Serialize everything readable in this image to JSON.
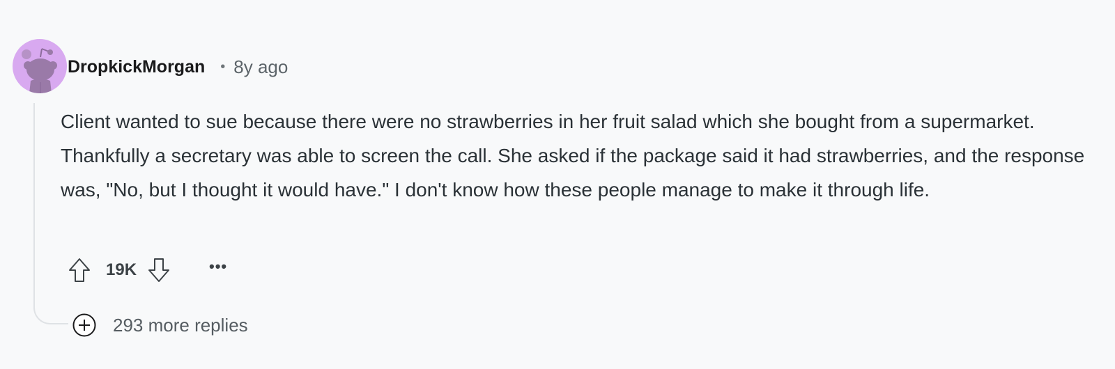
{
  "comment": {
    "author": "DropkickMorgan",
    "separator": "•",
    "age": "8y ago",
    "body": "Client wanted to sue because there were no strawberries in her fruit salad which she bought from a supermarket. Thankfully a secretary was able to screen the call. She asked if the package said it had strawberries, and the response was, \"No, but I thought it would have.\" I don't know how these people manage to make it through life.",
    "score": "19K",
    "more_label": "•••",
    "more_replies": "293 more replies"
  },
  "icons": {
    "avatar": "reddit-snoo-avatar",
    "upvote": "upvote-arrow-icon",
    "downvote": "downvote-arrow-icon",
    "more": "ellipsis-icon",
    "expand": "plus-circle-icon"
  },
  "colors": {
    "background": "#f8f9fa",
    "avatar_bg": "#d8a9f0",
    "avatar_figure": "#9a7aa8",
    "text": "#2a3136",
    "muted": "#5c6469",
    "thread_line": "#dfe2e5"
  }
}
